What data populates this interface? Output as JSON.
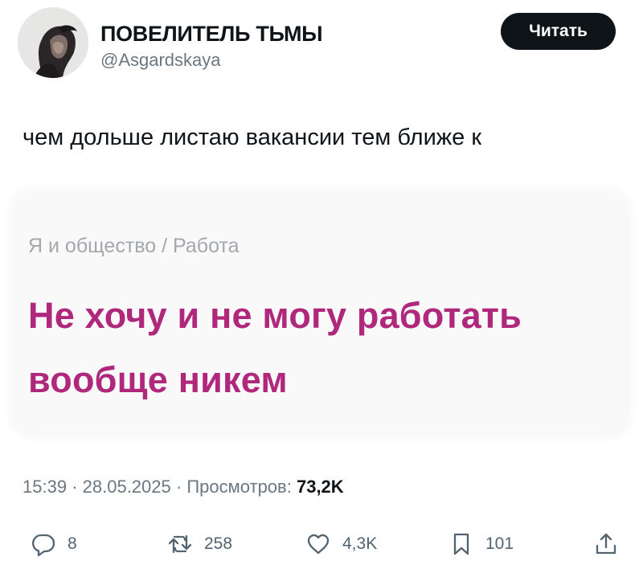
{
  "author": {
    "display_name": "ПОВЕЛИТЕЛЬ ТЬМЫ",
    "handle": "@Asgardskaya",
    "avatar_icon": "profile-avatar"
  },
  "follow_button": {
    "label": "Читать"
  },
  "tweet": {
    "text": "чем дольше листаю вакансии тем ближе к"
  },
  "media": {
    "breadcrumb": "Я и общество / Работа",
    "headline": "Не хочу и не могу работать вообще никем",
    "headline_color": "#b0287c"
  },
  "meta": {
    "time": "15:39",
    "date": "28.05.2025",
    "views_label": "Просмотров:",
    "views_count": "73,2K",
    "separator": "·"
  },
  "actions": {
    "reply": {
      "icon": "reply-icon",
      "count": "8"
    },
    "retweet": {
      "icon": "retweet-icon",
      "count": "258"
    },
    "like": {
      "icon": "heart-icon",
      "count": "4,3K"
    },
    "bookmark": {
      "icon": "bookmark-icon",
      "count": "101"
    },
    "share": {
      "icon": "share-icon"
    }
  },
  "colors": {
    "text_primary": "#0f1419",
    "text_secondary": "#6b7680",
    "button_bg": "#0f1419",
    "headline": "#b0287c"
  }
}
